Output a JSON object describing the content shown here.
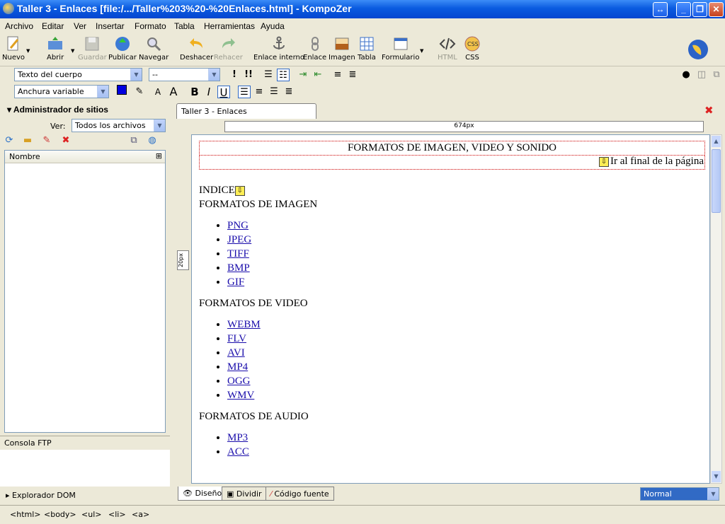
{
  "window": {
    "title": "Taller 3 - Enlaces [file:/.../Taller%203%20-%20Enlaces.html] - KompoZer"
  },
  "menu": [
    "Archivo",
    "Editar",
    "Ver",
    "Insertar",
    "Formato",
    "Tabla",
    "Herramientas",
    "Ayuda"
  ],
  "toolbar": {
    "nuevo": "Nuevo",
    "abrir": "Abrir",
    "guardar": "Guardar",
    "publicar": "Publicar",
    "navegar": "Navegar",
    "deshacer": "Deshacer",
    "rehacer": "Rehacer",
    "enlace_interno": "Enlace interno",
    "enlace": "Enlace",
    "imagen": "Imagen",
    "tabla": "Tabla",
    "formulario": "Formulario",
    "html": "HTML",
    "css": "CSS"
  },
  "format": {
    "paragraph": "Texto del cuerpo",
    "font": "--",
    "width": "Anchura variable"
  },
  "sidebar": {
    "title": "Administrador de sitios",
    "ver_label": "Ver:",
    "ver_value": "Todos los archivos",
    "column": "Nombre",
    "ftp": "Consola FTP",
    "dom": "Explorador DOM"
  },
  "editor": {
    "tab": "Taller 3 - Enlaces",
    "ruler": "674px",
    "vruler": "20px",
    "header": "FORMATOS DE IMAGEN, VIDEO Y SONIDO",
    "goto_end": "Ir al final de la página",
    "indice": "INDICE",
    "sections": [
      {
        "title": "FORMATOS DE IMAGEN",
        "items": [
          "PNG",
          "JPEG",
          "TIFF",
          "BMP",
          "GIF"
        ]
      },
      {
        "title": "FORMATOS DE VIDEO",
        "items": [
          "WEBM",
          "FLV",
          "AVI",
          "MP4",
          "OGG",
          "WMV"
        ]
      },
      {
        "title": "FORMATOS DE AUDIO",
        "items": [
          "MP3",
          "ACC"
        ]
      }
    ],
    "modes": {
      "design": "Diseño",
      "split": "Dividir",
      "source": "Código fuente"
    },
    "view_mode": "Normal"
  },
  "status": [
    "<html>",
    "<body>",
    "<ul>",
    "<li>",
    "<a>"
  ],
  "colors": {
    "titlebar": "#0a5be0",
    "link": "#1a0dab",
    "table_border": "#cc0000"
  }
}
